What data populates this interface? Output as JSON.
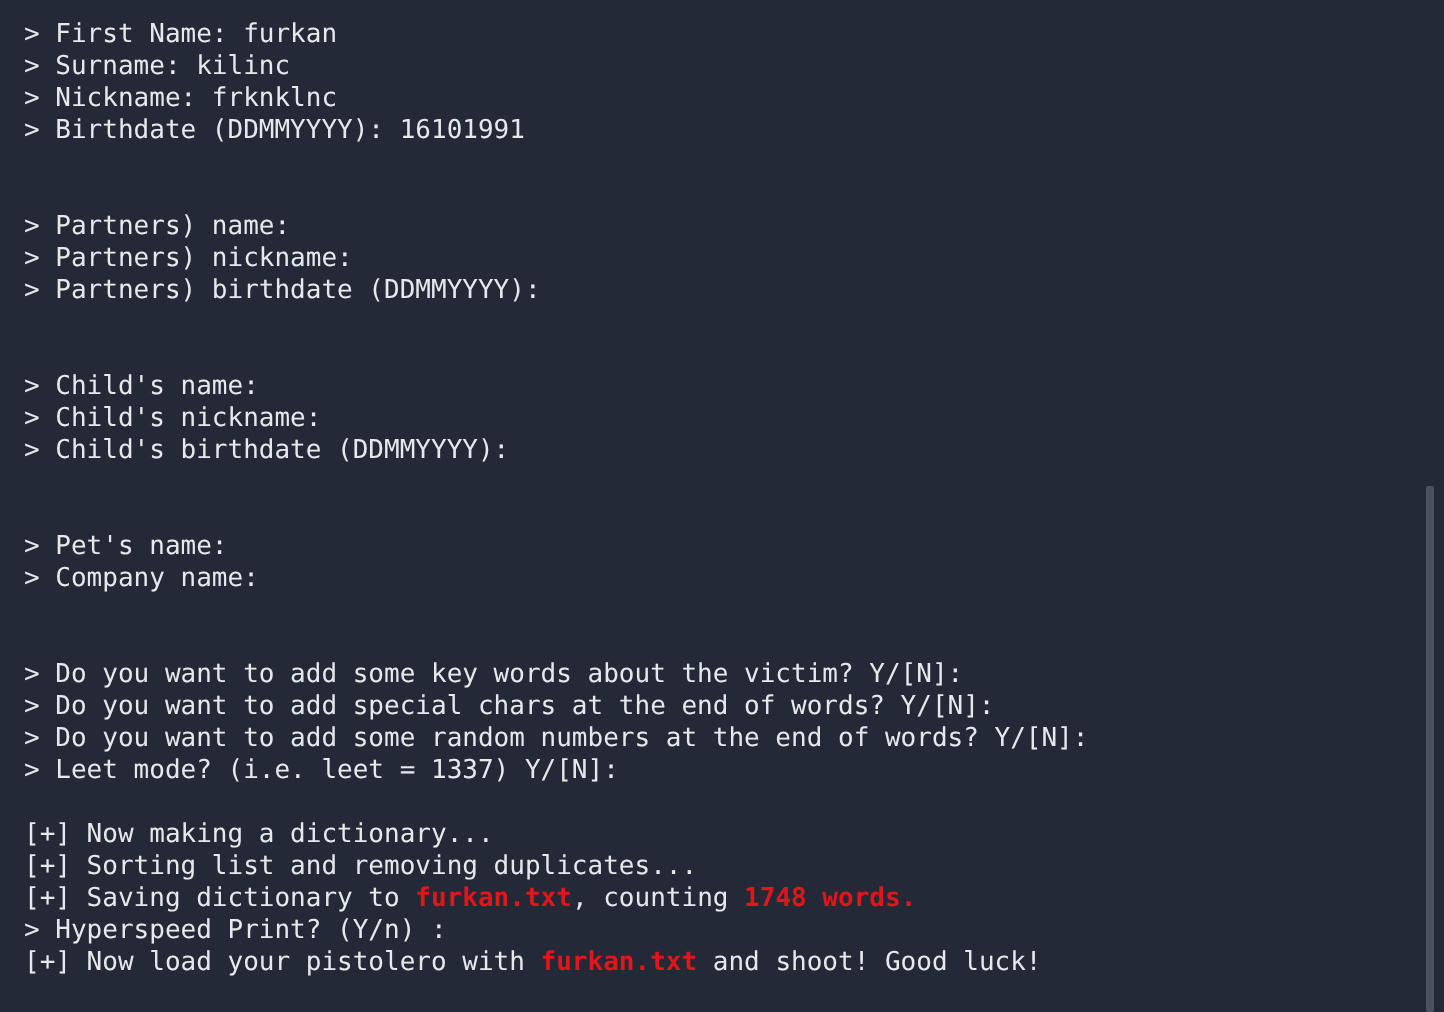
{
  "terminal": {
    "lines": [
      {
        "kind": "text",
        "text": "> First Name: furkan"
      },
      {
        "kind": "text",
        "text": "> Surname: kilinc"
      },
      {
        "kind": "text",
        "text": "> Nickname: frknklnc"
      },
      {
        "kind": "text",
        "text": "> Birthdate (DDMMYYYY): 16101991"
      },
      {
        "kind": "blank"
      },
      {
        "kind": "blank"
      },
      {
        "kind": "text",
        "text": "> Partners) name:"
      },
      {
        "kind": "text",
        "text": "> Partners) nickname:"
      },
      {
        "kind": "text",
        "text": "> Partners) birthdate (DDMMYYYY):"
      },
      {
        "kind": "blank"
      },
      {
        "kind": "blank"
      },
      {
        "kind": "text",
        "text": "> Child's name:"
      },
      {
        "kind": "text",
        "text": "> Child's nickname:"
      },
      {
        "kind": "text",
        "text": "> Child's birthdate (DDMMYYYY):"
      },
      {
        "kind": "blank"
      },
      {
        "kind": "blank"
      },
      {
        "kind": "text",
        "text": "> Pet's name:"
      },
      {
        "kind": "text",
        "text": "> Company name:"
      },
      {
        "kind": "blank"
      },
      {
        "kind": "blank"
      },
      {
        "kind": "text",
        "text": "> Do you want to add some key words about the victim? Y/[N]:"
      },
      {
        "kind": "text",
        "text": "> Do you want to add special chars at the end of words? Y/[N]:"
      },
      {
        "kind": "text",
        "text": "> Do you want to add some random numbers at the end of words? Y/[N]:"
      },
      {
        "kind": "text",
        "text": "> Leet mode? (i.e. leet = 1337) Y/[N]:"
      },
      {
        "kind": "blank"
      },
      {
        "kind": "text",
        "text": "[+] Now making a dictionary..."
      },
      {
        "kind": "text",
        "text": "[+] Sorting list and removing duplicates..."
      },
      {
        "kind": "text",
        "text": "[+] Saving dictionary to **furkan.txt**, counting **1748 words.**"
      },
      {
        "kind": "text",
        "text": "> Hyperspeed Print? (Y/n) :"
      },
      {
        "kind": "text",
        "text": "[+] Now load your pistolero with **furkan.txt** and shoot! Good luck!"
      }
    ]
  }
}
